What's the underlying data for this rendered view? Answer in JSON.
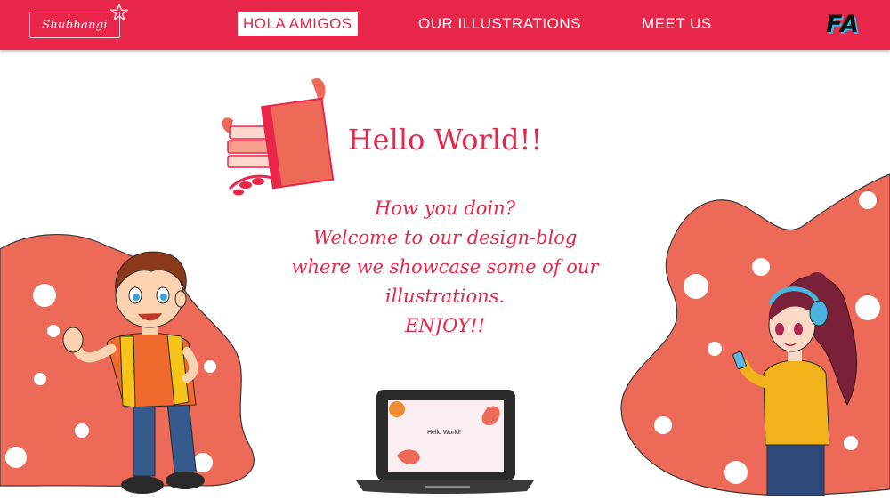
{
  "brand": {
    "logo_text": "Shubhangi",
    "badge": "FA"
  },
  "nav": [
    {
      "label": "HOLA AMIGOS",
      "active": true
    },
    {
      "label": "OUR ILLUSTRATIONS",
      "active": false
    },
    {
      "label": "MEET US",
      "active": false
    }
  ],
  "hero": {
    "title": "Hello World!!",
    "lines": [
      "How you doin?",
      "Welcome to our design-blog",
      "where we showcase some of our",
      "illustrations.",
      "ENJOY!!"
    ]
  },
  "laptop": {
    "screen_text": "Hello World!"
  },
  "colors": {
    "accent": "#e8264a",
    "blob": "#ee6a58",
    "ink": "#3a3a3a"
  },
  "icons": [
    "star-icon",
    "books-icon",
    "laptop-icon",
    "leaf-icon"
  ]
}
